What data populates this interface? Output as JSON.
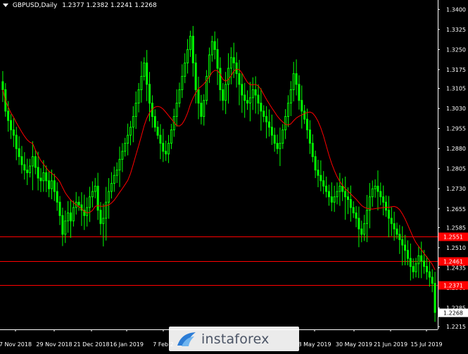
{
  "header": {
    "symbol_timeframe": "GBPUSD,Daily",
    "ohlc": "1.2377 1.2382 1.2241 1.2268"
  },
  "watermark": {
    "brand": "instaforex"
  },
  "colors": {
    "background": "#000000",
    "candle": "#00ff00",
    "moving_average": "#ff0000",
    "level_line": "#ff0000",
    "grid": "#404040",
    "text": "#ffffff"
  },
  "chart_data": {
    "type": "candlestick",
    "title": "GBPUSD,Daily",
    "ylim": [
      1.2205,
      1.3435
    ],
    "y_ticks": [
      "1.3400",
      "1.3325",
      "1.3250",
      "1.3175",
      "1.3105",
      "1.3030",
      "1.2955",
      "1.2880",
      "1.2805",
      "1.2730",
      "1.2655",
      "1.2585",
      "1.2510",
      "1.2435",
      "1.2360",
      "1.2285",
      "1.2215"
    ],
    "x_ticks": [
      "7 Nov 2018",
      "29 Nov 2018",
      "21 Dec 2018",
      "16 Jan 2019",
      "7 Feb 2019",
      "8 May 2019",
      "30 May 2019",
      "21 Jun 2019",
      "15 Jul 2019"
    ],
    "x_ticks_visible": [
      "7 Nov 2018",
      "29 Nov 2018",
      "21 Dec 2018",
      "16 Jan 2019",
      "7 Feb 2",
      "8 May 2019",
      "30 May 2019",
      "21 Jun 2019",
      "15 Jul 2019"
    ],
    "levels": [
      {
        "label": "1.2551",
        "value": 1.2551
      },
      {
        "label": "1.2461",
        "value": 1.2461
      },
      {
        "label": "1.2371",
        "value": 1.2371
      }
    ],
    "last_price_label": "1.2268",
    "last_price": 1.2268,
    "series_close": [
      1.31,
      1.302,
      1.2985,
      1.295,
      1.293,
      1.288,
      1.285,
      1.282,
      1.28,
      1.279,
      1.2815,
      1.285,
      1.281,
      1.277,
      1.276,
      1.279,
      1.276,
      1.273,
      1.276,
      1.272,
      1.268,
      1.263,
      1.256,
      1.261,
      1.264,
      1.261,
      1.266,
      1.268,
      1.267,
      1.265,
      1.263,
      1.266,
      1.27,
      1.272,
      1.274,
      1.265,
      1.26,
      1.262,
      1.268,
      1.272,
      1.275,
      1.278,
      1.28,
      1.284,
      1.287,
      1.29,
      1.293,
      1.296,
      1.3,
      1.305,
      1.31,
      1.315,
      1.32,
      1.312,
      1.305,
      1.3,
      1.296,
      1.293,
      1.29,
      1.287,
      1.286,
      1.29,
      1.295,
      1.3,
      1.305,
      1.31,
      1.315,
      1.32,
      1.325,
      1.33,
      1.32,
      1.31,
      1.305,
      1.3,
      1.306,
      1.315,
      1.323,
      1.328,
      1.325,
      1.318,
      1.31,
      1.306,
      1.312,
      1.318,
      1.322,
      1.32,
      1.316,
      1.312,
      1.308,
      1.306,
      1.305,
      1.307,
      1.31,
      1.308,
      1.305,
      1.302,
      1.3,
      1.298,
      1.296,
      1.293,
      1.29,
      1.288,
      1.29,
      1.295,
      1.3,
      1.305,
      1.31,
      1.316,
      1.312,
      1.306,
      1.302,
      1.299,
      1.295,
      1.29,
      1.285,
      1.28,
      1.278,
      1.276,
      1.274,
      1.272,
      1.27,
      1.268,
      1.27,
      1.272,
      1.274,
      1.272,
      1.27,
      1.269,
      1.266,
      1.264,
      1.262,
      1.258,
      1.256,
      1.26,
      1.265,
      1.27,
      1.273,
      1.274,
      1.272,
      1.27,
      1.268,
      1.265,
      1.262,
      1.26,
      1.258,
      1.256,
      1.254,
      1.252,
      1.25,
      1.247,
      1.244,
      1.242,
      1.245,
      1.248,
      1.246,
      1.244,
      1.242,
      1.24,
      1.2377,
      1.2268
    ]
  }
}
